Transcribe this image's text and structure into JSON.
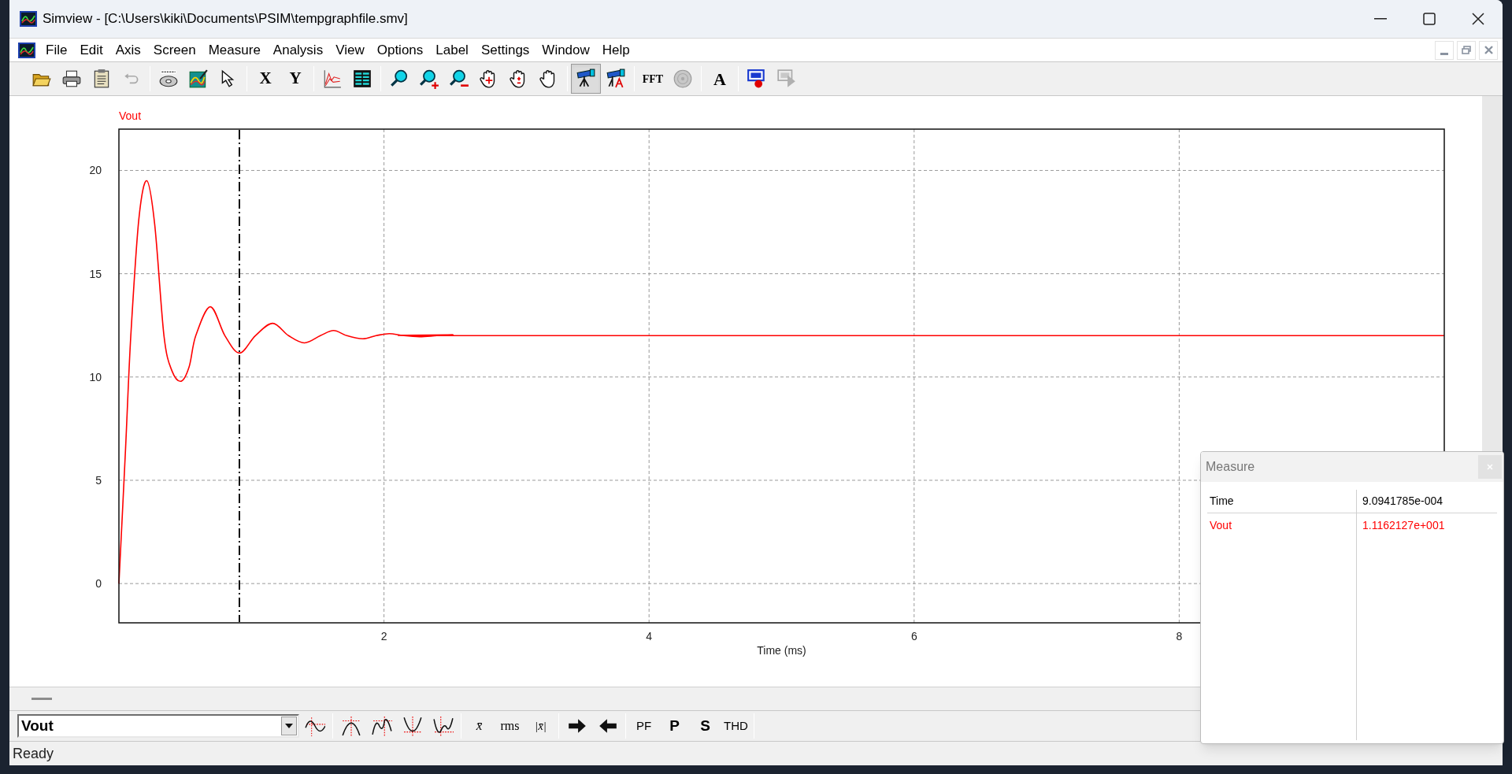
{
  "window": {
    "title": "Simview - [C:\\Users\\kiki\\Documents\\PSIM\\tempgraphfile.smv]"
  },
  "menu": [
    {
      "label": "File"
    },
    {
      "label": "Edit"
    },
    {
      "label": "Axis"
    },
    {
      "label": "Screen"
    },
    {
      "label": "Measure"
    },
    {
      "label": "Analysis"
    },
    {
      "label": "View"
    },
    {
      "label": "Options"
    },
    {
      "label": "Label"
    },
    {
      "label": "Settings"
    },
    {
      "label": "Window"
    },
    {
      "label": "Help"
    }
  ],
  "toolbar": {
    "text_buttons": [
      "X",
      "Y",
      "FFT",
      "A"
    ],
    "cursor_tool": {
      "selected": true
    }
  },
  "plot": {
    "chart_data": {
      "type": "line",
      "xlabel": "Time (ms)",
      "xlim": [
        0,
        10
      ],
      "ylim": [
        -1.9,
        22
      ],
      "xticks": [
        2,
        4,
        6,
        8
      ],
      "yticks": [
        0,
        5,
        10,
        15,
        20
      ],
      "x": [
        0,
        0.05,
        0.09,
        0.15,
        0.21,
        0.27,
        0.34,
        0.4,
        0.47,
        0.53,
        0.58,
        0.69,
        0.8,
        0.91,
        1.03,
        1.16,
        1.28,
        1.4,
        1.52,
        1.62,
        1.72,
        1.84,
        1.94,
        2.04,
        2.15,
        2.27,
        2.4,
        2.52,
        2.7,
        10
      ],
      "series": [
        {
          "name": "Vout",
          "color": "#ff0000",
          "values": [
            0,
            6.5,
            12,
            17.6,
            19.5,
            17.4,
            12,
            10.3,
            9.8,
            10.5,
            12,
            13.4,
            12,
            11.16,
            12,
            12.6,
            12,
            11.65,
            12,
            12.25,
            12,
            11.85,
            12,
            12.1,
            12,
            11.95,
            12,
            12.04,
            12,
            12
          ]
        }
      ],
      "grid": true,
      "ref_lines": [
        {
          "axis": "x",
          "value": 0.909
        }
      ]
    }
  },
  "signal_selector": {
    "value": "Vout"
  },
  "analysis_toolbar": {
    "text_buttons": [
      "x̄",
      "rms",
      "|x̄|",
      "PF",
      "P",
      "S",
      "THD"
    ]
  },
  "status_bar": {
    "text": "Ready"
  },
  "measure": {
    "title": "Measure",
    "rows": [
      {
        "label": "Time",
        "value": "9.0941785e-004",
        "color": "#000000"
      },
      {
        "label": "Vout",
        "value": "1.1162127e+001",
        "color": "#ff0000"
      }
    ]
  }
}
